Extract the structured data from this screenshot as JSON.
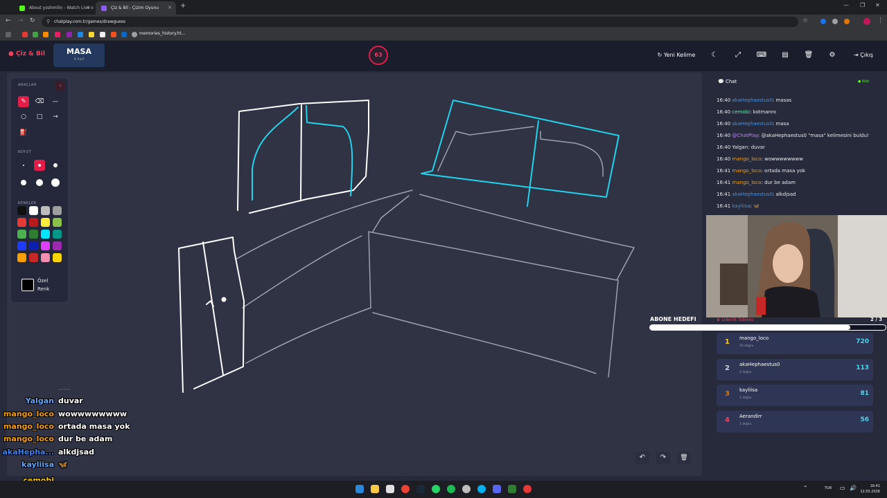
{
  "browser": {
    "tabs": [
      {
        "title": "About yoshmilin - Watch Live o",
        "active": false
      },
      {
        "title": "Çiz & Bil - Çizim Oyunu",
        "active": true
      }
    ],
    "url": "chatplay.com.tr/games/drawguess",
    "bookmark_label": "memories_history.ht..."
  },
  "app": {
    "logo": "Çiz & Bil",
    "word_card": {
      "word": "MASA",
      "hint": "4 harf"
    },
    "timer": "63",
    "buttons": {
      "new_word": "Yeni Kelime",
      "exit": "Çıkış"
    }
  },
  "tools": {
    "section_tools": "ARAÇLAR",
    "section_size": "BOYUT",
    "section_colors": "RENKLER",
    "custom_color": [
      "Özel",
      "Renk"
    ],
    "colors": [
      "#111111",
      "#ffffff",
      "#bdbdbd",
      "#9e9e9e",
      "#e53935",
      "#b71c1c",
      "#ffeb3b",
      "#8bc34a",
      "#4caf50",
      "#2e7d32",
      "#00e5ff",
      "#009688",
      "#1e3cff",
      "#0d1fb0",
      "#e040fb",
      "#9c27b0",
      "#ffa000",
      "#c62828",
      "#f48fb1",
      "#ffd600"
    ]
  },
  "chat": {
    "title": "Chat",
    "status": "Kick",
    "messages": [
      {
        "time": "16:40",
        "user": "akaHephaestus0",
        "color": "#4a90e2",
        "text": "masas"
      },
      {
        "time": "16:40",
        "user": "cemobi",
        "color": "#6ee7b7",
        "text": "kotmanro"
      },
      {
        "time": "16:40",
        "user": "akaHephaestus0",
        "color": "#4a90e2",
        "text": "masa"
      },
      {
        "time": "16:40",
        "user": "@ChatPlay",
        "color": "#c084fc",
        "text": "@akaHephaestus0 \"masa\" kelimesini buldu!"
      },
      {
        "time": "16:40",
        "user": "Yalgan",
        "color": "#e8eaed",
        "text": "duvar"
      },
      {
        "time": "16:40",
        "user": "mango_loco",
        "color": "#f59e0b",
        "text": "wowwwwwwww"
      },
      {
        "time": "16:41",
        "user": "mango_loco",
        "color": "#f59e0b",
        "text": "ortada masa yok"
      },
      {
        "time": "16:41",
        "user": "mango_loco",
        "color": "#f59e0b",
        "text": "dur be adam"
      },
      {
        "time": "16:41",
        "user": "akaHephaestus0",
        "color": "#4a90e2",
        "text": "alkdjsad"
      },
      {
        "time": "16:41",
        "user": "kayliisa",
        "color": "#4a90e2",
        "text": "🦋"
      }
    ]
  },
  "leaderboard": {
    "title": "Liderlik Tablosu",
    "page": "2 / 3",
    "goal_label": "ABONE HEDEFI",
    "goal_progress": 0.85,
    "entries": [
      {
        "rank": "1",
        "name": "mango_loco",
        "sub": "10 doğru",
        "score": "720",
        "color": "#facc15"
      },
      {
        "rank": "2",
        "name": "akaHephaestus0",
        "sub": "2 doğru",
        "score": "113",
        "color": "#cbd5e1"
      },
      {
        "rank": "3",
        "name": "kayliisa",
        "sub": "1 doğru",
        "score": "81",
        "color": "#d97706"
      },
      {
        "rank": "4",
        "name": "Aerandirr",
        "sub": "1 doğru",
        "score": "56",
        "color": "#f43f5e"
      }
    ]
  },
  "overlay_chat": [
    {
      "user": "Yalgan",
      "color": "#60a5fa",
      "text": "duvar"
    },
    {
      "user": "mango_loco",
      "color": "#f59e0b",
      "text": "wowwwwwwww"
    },
    {
      "user": "mango_loco",
      "color": "#f59e0b",
      "text": "ortada masa yok"
    },
    {
      "user": "mango_loco",
      "color": "#f59e0b",
      "text": "dur be adam"
    },
    {
      "user": "akaHepha...",
      "color": "#3b82f6",
      "text": "alkdjsad"
    },
    {
      "user": "kayliisa",
      "color": "#60a5fa",
      "text": "🦋"
    },
    {
      "user": "cemobi",
      "color": "#facc15",
      "text": ""
    }
  ],
  "taskbar": {
    "lang": "TUR",
    "time": "16:41",
    "date": "12.05.2026"
  }
}
